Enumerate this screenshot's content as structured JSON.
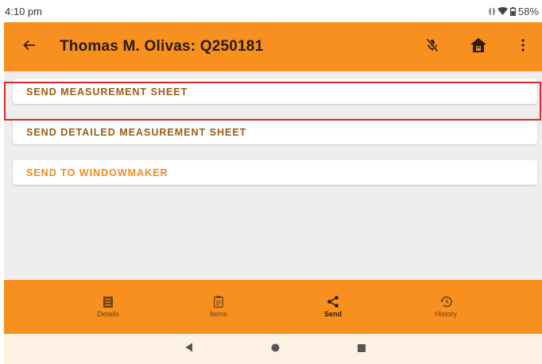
{
  "status": {
    "time": "4:10 pm",
    "battery": "58%"
  },
  "appbar": {
    "title": "Thomas M. Olivas: Q250181",
    "icons": [
      "back-arrow-icon",
      "mic-off-icon",
      "home-icon",
      "more-vert-icon"
    ]
  },
  "actions": [
    {
      "label": "SEND MEASUREMENT SHEET"
    },
    {
      "label": "SEND DETAILED MEASUREMENT SHEET"
    },
    {
      "label": "SEND TO WINDOWMAKER",
      "highlighted": true
    }
  ],
  "bottom_nav": [
    {
      "label": "Details",
      "icon": "list-icon",
      "active": false
    },
    {
      "label": "Items",
      "icon": "clipboard-icon",
      "active": false
    },
    {
      "label": "Send",
      "icon": "share-icon",
      "active": true
    },
    {
      "label": "History",
      "icon": "history-icon",
      "active": false
    }
  ],
  "colors": {
    "accent": "#f7901e",
    "highlight_border": "#e0262b",
    "action_text": "#9c5a12",
    "highlight_text": "#f08a1c"
  }
}
